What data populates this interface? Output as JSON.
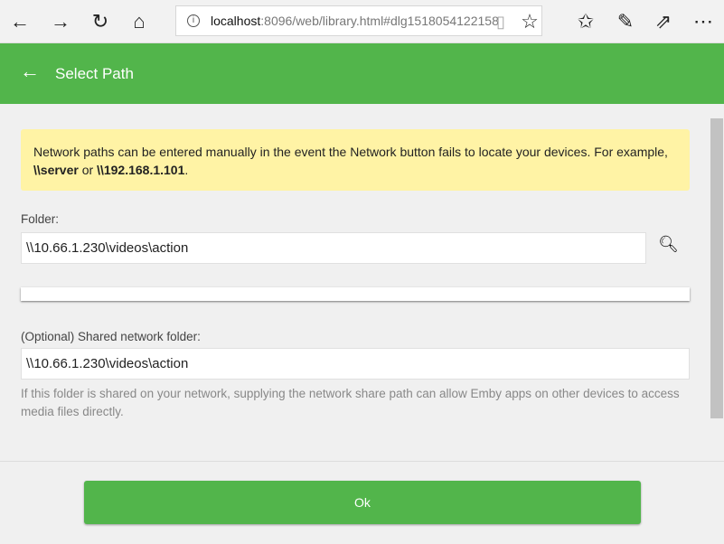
{
  "browser": {
    "url_host": "localhost",
    "url_rest": ":8096/web/library.html#dlg1518054122158"
  },
  "dialog": {
    "title": "Select Path",
    "note_text_1": "Network paths can be entered manually in the event the Network button fails to locate your devices. For example, ",
    "note_bold_1": "\\\\server",
    "note_or": " or ",
    "note_bold_2": "\\\\192.168.1.101",
    "note_end": ".",
    "folder_label": "Folder:",
    "folder_value": "\\\\10.66.1.230\\videos\\action",
    "shared_label": "(Optional) Shared network folder:",
    "shared_value": "\\\\10.66.1.230\\videos\\action",
    "shared_help": "If this folder is shared on your network, supplying the network share path can allow Emby apps on other devices to access media files directly.",
    "ok_label": "Ok"
  },
  "colors": {
    "accent": "#52b54b",
    "note_bg": "#fff3a5"
  }
}
